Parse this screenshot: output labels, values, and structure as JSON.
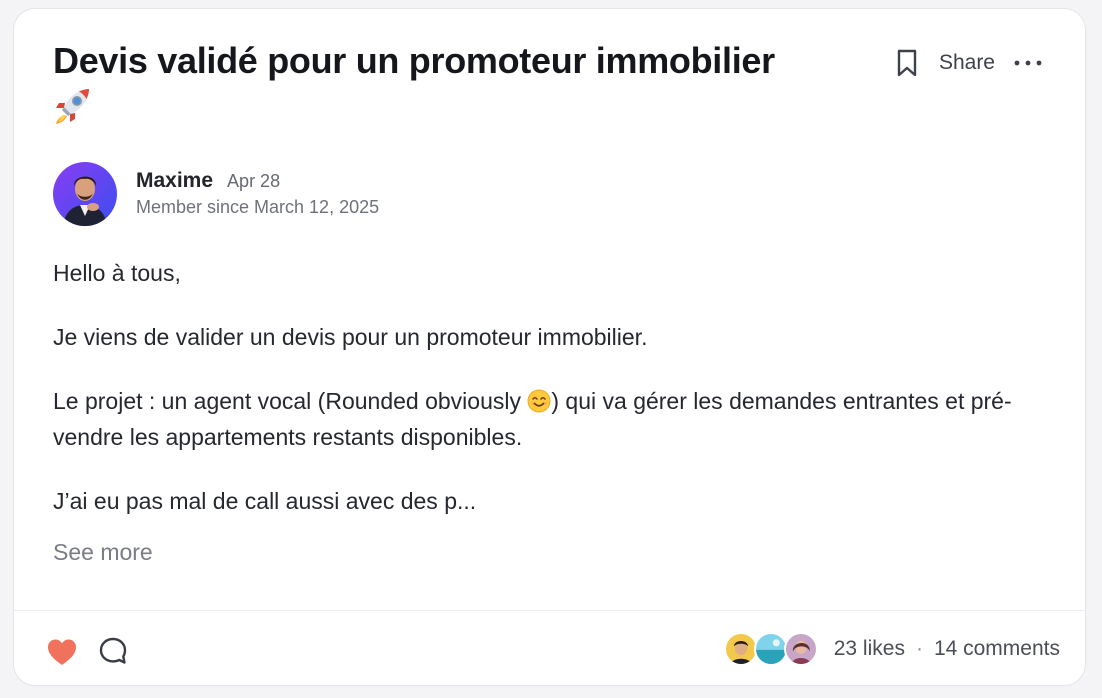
{
  "post": {
    "title": "Devis validé pour un promoteur immobilier",
    "title_icon": "rocket-icon",
    "actions": {
      "bookmark_icon": "bookmark-icon",
      "share_label": "Share",
      "more_icon": "more-icon"
    },
    "author": {
      "name": "Maxime",
      "date": "Apr 28",
      "member_since": "Member since March 12, 2025"
    },
    "body": {
      "paragraph_1": "Hello à tous,",
      "paragraph_2": "Je viens de valider un devis pour un promoteur immobilier.",
      "paragraph_3_before": "Le projet : un agent vocal (Rounded obviously ",
      "paragraph_3_icon": "smiling-face-emoji-icon",
      "paragraph_3_after": ") qui va gérer les demandes entrantes et pré-vendre les appartements restants disponibles.",
      "paragraph_4": "J’ai eu pas mal de call aussi avec des p..."
    },
    "see_more_label": "See more",
    "footer": {
      "like_icon": "heart-icon",
      "comment_icon": "comment-bubble-icon",
      "likes_label": "23 likes",
      "separator": "·",
      "comments_label": "14 comments"
    }
  },
  "colors": {
    "background": "#f4f4f7",
    "card": "#ffffff",
    "border": "#e4e4e9",
    "heart": "#f0715c",
    "text_primary": "#15171c",
    "text_muted": "#6f727b"
  }
}
